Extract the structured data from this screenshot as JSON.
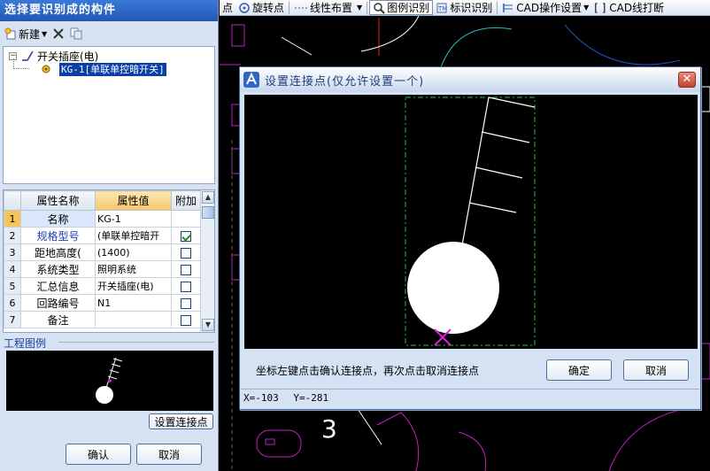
{
  "toolbar": {
    "items": [
      {
        "label": "点",
        "icon": "point-icon"
      },
      {
        "label": "旋转点",
        "icon": "rotate-point-icon"
      },
      {
        "label": "线性布置",
        "icon": "linear-layout-icon"
      },
      {
        "label": "图例识别",
        "icon": "legend-recognize-icon"
      },
      {
        "label": "标识识别",
        "icon": "mark-recognize-icon"
      },
      {
        "label": "CAD操作设置",
        "icon": "cad-settings-icon"
      },
      {
        "label": "[ ] CAD线打断",
        "icon": "cad-break-icon"
      }
    ]
  },
  "left_panel": {
    "title": "选择要识别成的构件",
    "new_label": "新建",
    "tree": {
      "root_label": "开关插座(电)",
      "child_label": "KG-1[单联单控暗开关]"
    },
    "grid": {
      "headers": [
        "属性名称",
        "属性值",
        "附加"
      ],
      "rows": [
        {
          "num": "1",
          "name": "名称",
          "value": "KG-1",
          "checked": null
        },
        {
          "num": "2",
          "name": "规格型号",
          "value": "(单联单控暗开",
          "checked": true
        },
        {
          "num": "3",
          "name": "距地高度(",
          "value": "(1400)",
          "checked": false
        },
        {
          "num": "4",
          "name": "系统类型",
          "value": "照明系统",
          "checked": false
        },
        {
          "num": "5",
          "name": "汇总信息",
          "value": "开关插座(电)",
          "checked": false
        },
        {
          "num": "6",
          "name": "回路编号",
          "value": "N1",
          "checked": false
        },
        {
          "num": "7",
          "name": "备注",
          "value": "",
          "checked": false
        }
      ]
    },
    "legend_title": "工程图例",
    "set_point_label": "设置连接点",
    "ok_label": "确认",
    "cancel_label": "取消"
  },
  "cad": {
    "number_label": "3"
  },
  "dialog": {
    "title": "设置连接点(仅允许设置一个)",
    "instruction": "坐标左键点击确认连接点，再次点击取消连接点",
    "ok_label": "确定",
    "cancel_label": "取消",
    "x_readout": "X=-103",
    "y_readout": "Y=-281"
  },
  "colors": {
    "title_bar": "#2f68c6",
    "cad_background": "#000000",
    "cad_magenta": "#c020c0",
    "cad_green": "#20c040",
    "selection": "#0a3fa8"
  }
}
